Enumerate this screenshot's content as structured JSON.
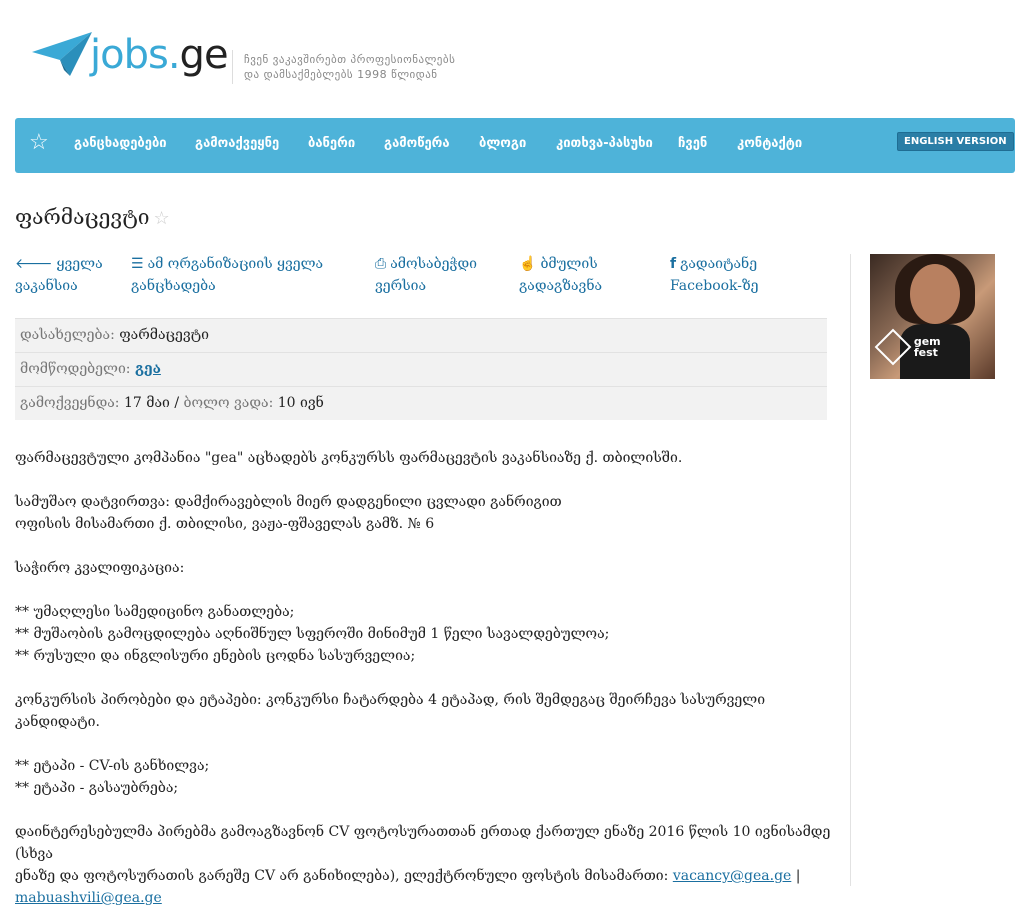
{
  "header": {
    "logo_jobs": "jobs",
    "logo_dot": ".",
    "logo_ge": "ge",
    "tagline_1": "ჩვენ ვაკავშირებთ პროფესიონალებს",
    "tagline_2": "და დამსაქმებლებს 1998 წლიდან"
  },
  "nav": {
    "items": [
      "განცხადებები",
      "გამოაქვეყნე",
      "ბანერი",
      "გამოწერა",
      "ბლოგი",
      "კითხვა-პასუხი",
      "ჩვენ",
      "კონტაქტი"
    ],
    "english": "ENGLISH VERSION"
  },
  "job": {
    "title": "ფარმაცევტი",
    "actions": {
      "all_1": "ყველა",
      "all_2": "ვაკანსია",
      "org_1": "ამ ორგანიზაციის ყველა",
      "org_2": "განცხადება",
      "print_1": "ამოსაბეჭდი",
      "print_2": "ვერსია",
      "friend_1": "ბმულის",
      "friend_2": "გადაგზავნა",
      "fb_1": "გადაიტანე",
      "fb_2": "Facebook-ზე"
    },
    "info": {
      "title_label": "დასახელება:",
      "title_value": "ფარმაცევტი",
      "provider_label": "მომწოდებელი:",
      "provider_value": "გეა",
      "published_label": "გამოქვეყნდა:",
      "published_value": "17 მაი",
      "sep": "/",
      "deadline_label": "ბოლო ვადა:",
      "deadline_value": "10 ივნ"
    },
    "body": {
      "p1": "ფარმაცევტული კომპანია \"gea\" აცხადებს კონკურსს ფარმაცევტის ვაკანსიაზე ქ. თბილისში.",
      "p2a": "სამუშაო დატვირთვა: დამქირავებლის მიერ დადგენილი ცვლადი განრიგით",
      "p2b": "ოფისის მისამართი ქ. თბილისი, ვაჟა-ფშაველას გამზ. № 6",
      "p3": "საჭირო კვალიფიკაცია:",
      "l1": "** უმაღლესი სამედიცინო განათლება;",
      "l2": "** მუშაობის გამოცდილება აღნიშნულ სფეროში მინიმუმ 1 წელი სავალდებულოა;",
      "l3": "** რუსული და ინგლისური ენების ცოდნა სასურველია;",
      "p4": "კონკურსის პირობები და ეტაპები: კონკურსი ჩატარდება 4 ეტაპად, რის შემდეგაც შეირჩევა სასურველი კანდიდატი.",
      "s1": "** ეტაპი - CV-ის განხილვა;",
      "s2": "** ეტაპი - გასაუბრება;",
      "p5a": "დაინტერესებულმა პირებმა გამოაგზავნონ CV ფოტოსურათთან ერთად ქართულ ენაზე 2016 წლის 10 ივნისამდე (სხვა",
      "p5b": "ენაზე და ფოტოსურათის გარეშე CV არ განიხილება), ელექტრონული ფოსტის მისამართი: ",
      "email1": "vacancy@gea.ge",
      "pipe": " |",
      "email2": "mabuashvili@gea.ge"
    }
  },
  "banner": {
    "text_1": "gem",
    "text_2": "fest"
  }
}
